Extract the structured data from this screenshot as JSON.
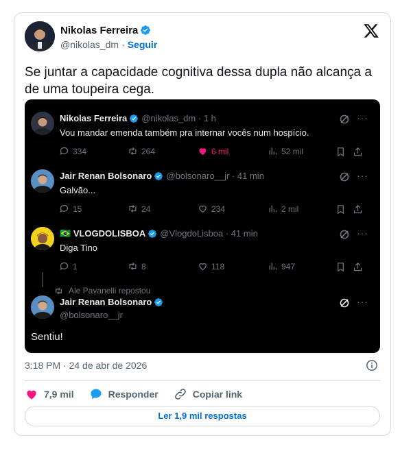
{
  "author": {
    "name": "Nikolas Ferreira",
    "handle": "@nikolas_dm",
    "separator": "·",
    "follow_label": "Seguir"
  },
  "tweet": {
    "text": "Se juntar a capacidade cognitiva dessa dupla não alcança a de uma toupeira cega.",
    "timestamp": "3:18 PM · 24 de abr de 2026"
  },
  "embed": {
    "replies": [
      {
        "name": "Nikolas Ferreira",
        "meta": "@nikolas_dm · 1 h",
        "text": "Vou mandar emenda também pra internar vocês num hospício.",
        "stats": {
          "replies": "334",
          "reposts": "264",
          "likes": "6 mil",
          "views": "52 mil"
        },
        "liked": true
      },
      {
        "name": "Jair Renan Bolsonaro",
        "meta": "@bolsonaro__jr · 41 min",
        "text": "Galvão...",
        "stats": {
          "replies": "15",
          "reposts": "24",
          "likes": "234",
          "views": "2 mil"
        },
        "liked": false
      },
      {
        "name": "VLOGDOLISBOA",
        "flag": "🇧🇷",
        "meta": "@VlogdoLisboa · 41 min",
        "text": "Diga Tino",
        "stats": {
          "replies": "1",
          "reposts": "8",
          "likes": "118",
          "views": "947"
        },
        "liked": false
      }
    ],
    "repost_note": "Ale Pavanelli repostou",
    "final": {
      "name": "Jair Renan Bolsonaro",
      "handle": "@bolsonaro__jr",
      "text": "Sentiu!"
    },
    "more_glyph": "···"
  },
  "actions": {
    "likes_count": "7,9 mil",
    "reply_label": "Responder",
    "copy_label": "Copiar link",
    "read_replies": "Ler 1,9 mil respostas"
  },
  "colors": {
    "accent": "#1d9bf0",
    "like": "#f91880",
    "link": "#006fd6"
  }
}
